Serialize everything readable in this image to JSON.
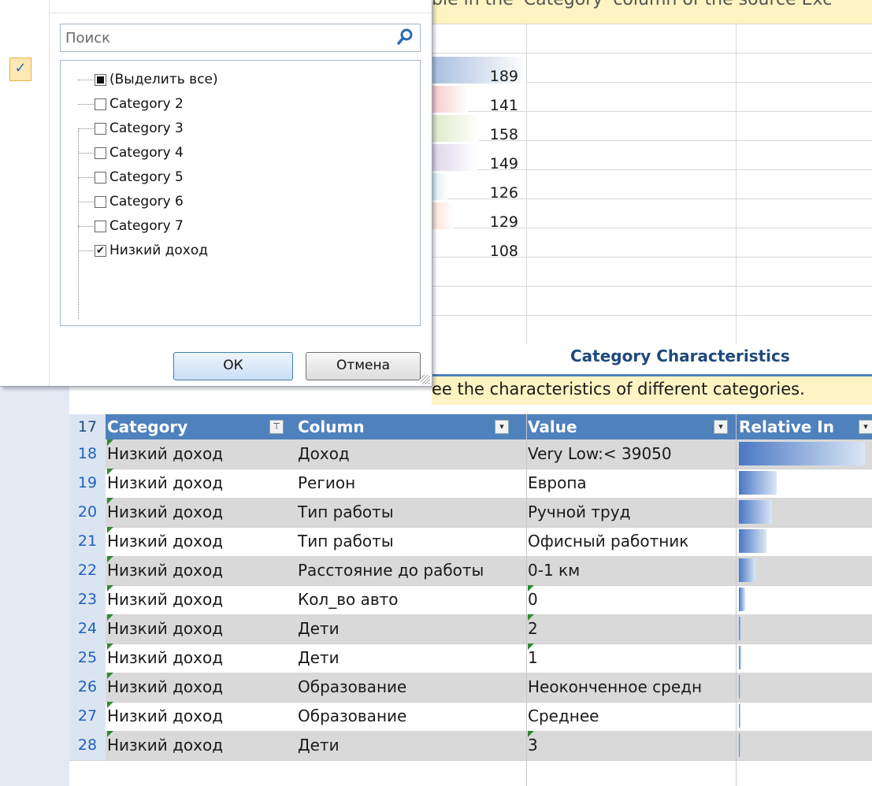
{
  "top_banner": "ble in the 'Category' column of the source Exc",
  "upper_values": [
    "189",
    "141",
    "158",
    "149",
    "126",
    "129",
    "108"
  ],
  "upper_bar_colors": [
    "#a8bfe0",
    "#f4c9c9",
    "#dfe9c8",
    "#ddd4e9",
    "#d7ecf3",
    "#fce1d4"
  ],
  "section_title": "Category Characteristics",
  "section_desc": "ee the characteristics of different categories.",
  "dialog": {
    "search_placeholder": "Поиск",
    "items": [
      {
        "label": "(Выделить все)",
        "state": "mixed"
      },
      {
        "label": "Category 2",
        "state": "off"
      },
      {
        "label": "Category 3",
        "state": "off"
      },
      {
        "label": "Category 4",
        "state": "off"
      },
      {
        "label": "Category 5",
        "state": "off"
      },
      {
        "label": "Category 6",
        "state": "off"
      },
      {
        "label": "Category 7",
        "state": "off"
      },
      {
        "label": "Низкий доход",
        "state": "on"
      }
    ],
    "ok_label": "ОК",
    "cancel_label": "Отмена",
    "checkmark": "✓"
  },
  "table": {
    "header_row_num": "17",
    "headers": [
      "Category",
      "Column",
      "Value",
      "Relative In"
    ],
    "rows": [
      {
        "n": "18",
        "category": "Низкий доход",
        "column": "Доход",
        "value": "Very Low:< 39050",
        "ri": 1.0
      },
      {
        "n": "19",
        "category": "Низкий доход",
        "column": "Регион",
        "value": "Европа",
        "ri": 0.3
      },
      {
        "n": "20",
        "category": "Низкий доход",
        "column": "Тип работы",
        "value": "Ручной труд",
        "ri": 0.26
      },
      {
        "n": "21",
        "category": "Низкий доход",
        "column": "Тип работы",
        "value": "Офисный работник",
        "ri": 0.22
      },
      {
        "n": "22",
        "category": "Низкий доход",
        "column": "Расстояние до работы",
        "value": "0-1 км",
        "ri": 0.13
      },
      {
        "n": "23",
        "category": "Низкий доход",
        "column": "Кол_во авто",
        "value": "0",
        "ri": 0.05
      },
      {
        "n": "24",
        "category": "Низкий доход",
        "column": "Дети",
        "value": "2",
        "ri": 0.02
      },
      {
        "n": "25",
        "category": "Низкий доход",
        "column": "Дети",
        "value": "1",
        "ri": 0.02
      },
      {
        "n": "26",
        "category": "Низкий доход",
        "column": "Образование",
        "value": "Неоконченное средн",
        "ri": 0.01
      },
      {
        "n": "27",
        "category": "Низкий доход",
        "column": "Образование",
        "value": "Среднее",
        "ri": 0.01
      },
      {
        "n": "28",
        "category": "Низкий доход",
        "column": "Дети",
        "value": "3",
        "ri": 0.01
      }
    ]
  }
}
